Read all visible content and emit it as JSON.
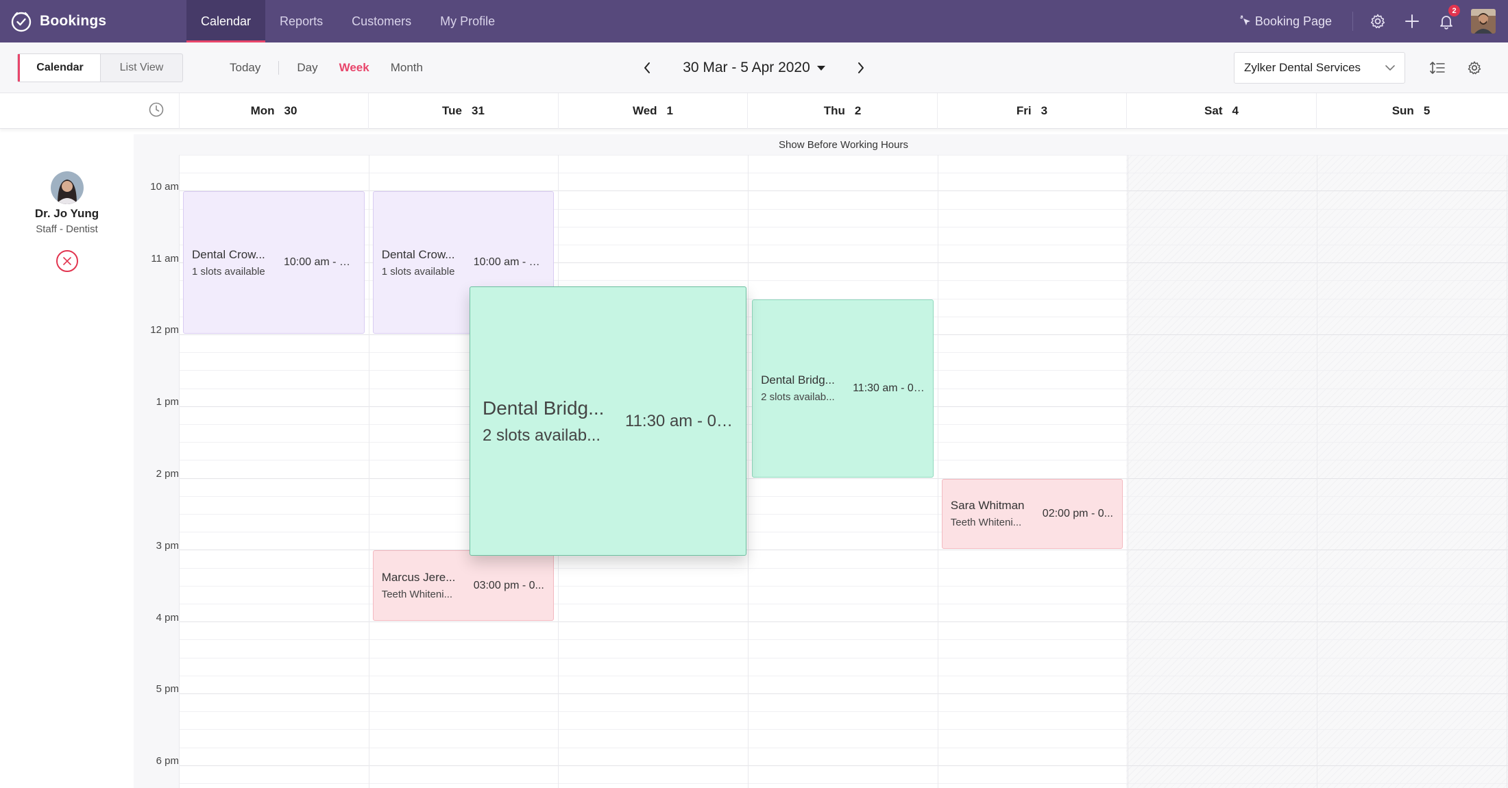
{
  "app": {
    "name": "Bookings"
  },
  "nav": {
    "tabs": [
      {
        "label": "Calendar",
        "active": true
      },
      {
        "label": "Reports"
      },
      {
        "label": "Customers"
      },
      {
        "label": "My Profile"
      }
    ],
    "booking_page": "Booking Page",
    "notifications_count": "2"
  },
  "toolbar": {
    "view_calendar": "Calendar",
    "view_list": "List View",
    "today": "Today",
    "day": "Day",
    "week": "Week",
    "month": "Month",
    "active_range": "Week",
    "date_range": "30 Mar - 5 Apr 2020",
    "service": "Zylker Dental Services"
  },
  "days": [
    {
      "name": "Mon",
      "num": "30"
    },
    {
      "name": "Tue",
      "num": "31"
    },
    {
      "name": "Wed",
      "num": "1"
    },
    {
      "name": "Thu",
      "num": "2"
    },
    {
      "name": "Fri",
      "num": "3"
    },
    {
      "name": "Sat",
      "num": "4"
    },
    {
      "name": "Sun",
      "num": "5"
    }
  ],
  "staff": {
    "name": "Dr. Jo Yung",
    "role": "Staff - Dentist"
  },
  "before_hours_label": "Show Before Working Hours",
  "hours": [
    "10 am",
    "11 am",
    "12 pm",
    "1 pm",
    "2 pm",
    "3 pm",
    "4 pm",
    "5 pm",
    "6 pm"
  ],
  "events": [
    {
      "day": 0,
      "start": "10:00",
      "end": "12:00",
      "title": "Dental Crow...",
      "sub": "1 slots available",
      "time": "10:00 am - 12...",
      "color": "purple"
    },
    {
      "day": 1,
      "start": "10:00",
      "end": "12:00",
      "title": "Dental Crow...",
      "sub": "1 slots available",
      "time": "10:00 am - 12...",
      "color": "purple"
    },
    {
      "day": 3,
      "start": "11:30",
      "end": "14:00",
      "title": "Dental Bridg...",
      "sub": "2 slots availab...",
      "time": "11:30 am - 02...",
      "color": "green"
    },
    {
      "day": 4,
      "start": "14:00",
      "end": "15:00",
      "title": "Sara Whitman",
      "sub": "Teeth Whiteni...",
      "time": "02:00 pm - 0...",
      "color": "red"
    },
    {
      "day": 1,
      "start": "15:00",
      "end": "16:00",
      "title": "Marcus Jere...",
      "sub": "Teeth Whiteni...",
      "time": "03:00 pm - 0...",
      "color": "red"
    }
  ],
  "dragged_event": {
    "title": "Dental Bridg...",
    "sub": "2 slots availab...",
    "time": "11:30 am - 02..."
  },
  "colors": {
    "topbar": "#57497c",
    "accent": "#e8456b",
    "event_purple": "#f2ecfc",
    "event_green": "#c6f5e3",
    "event_red": "#fce1e4"
  }
}
